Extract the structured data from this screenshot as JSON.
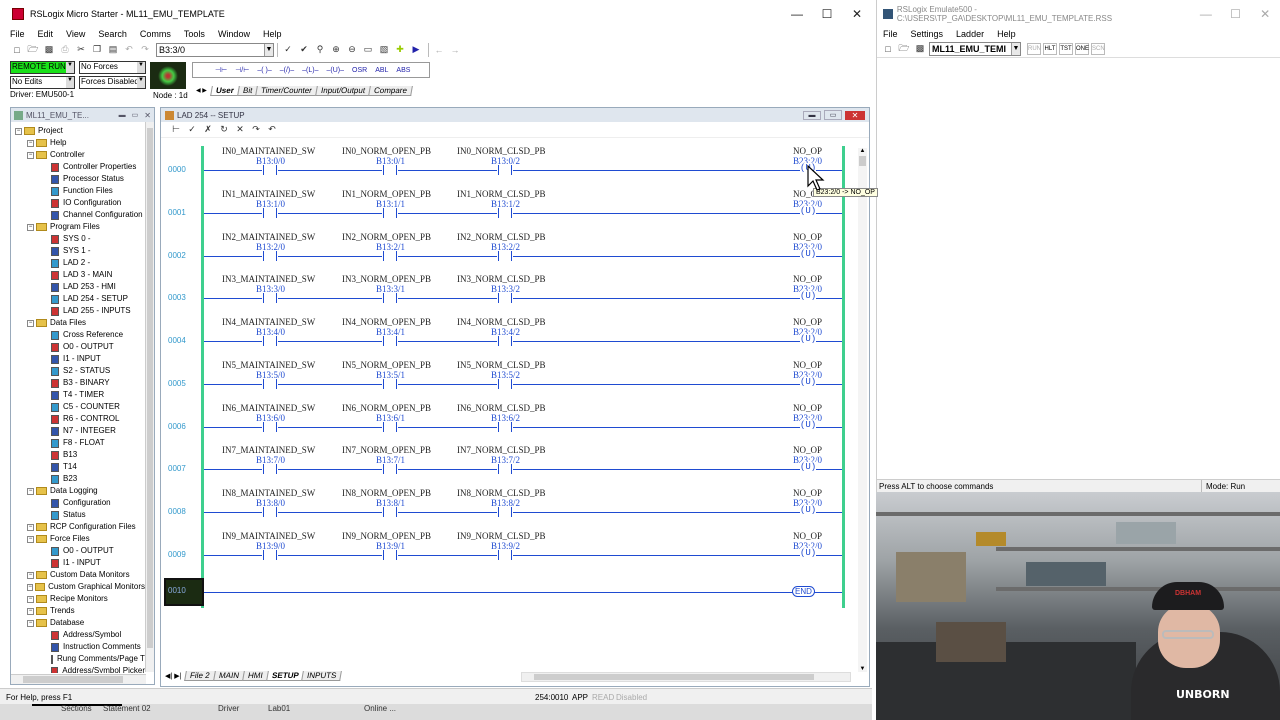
{
  "left_app": {
    "title": "RSLogix Micro Starter - ML11_EMU_TEMPLATE",
    "menu": [
      "File",
      "Edit",
      "View",
      "Search",
      "Comms",
      "Tools",
      "Window",
      "Help"
    ],
    "address_box": "B3:3/0",
    "status": {
      "mode": "REMOTE RUN",
      "edits": "No Edits",
      "forces": "No Forces",
      "forces_enabled": "Forces Disabled",
      "driver": "Driver: EMU500-1",
      "node": "Node : 1d"
    },
    "instr_tabs": [
      "User",
      "Bit",
      "Timer/Counter",
      "Input/Output",
      "Compare"
    ],
    "instr_symbols": [
      "⊣⊢",
      "⊣/⊢",
      "–( )–",
      "–(/)–",
      "–(L)–",
      "–(U)–",
      "OSR",
      "ABL",
      "ABS"
    ]
  },
  "project_tree": {
    "title": "ML11_EMU_TE...",
    "items": [
      {
        "label": "Project",
        "level": 0,
        "kind": "folder"
      },
      {
        "label": "Help",
        "level": 1,
        "kind": "folder"
      },
      {
        "label": "Controller",
        "level": 1,
        "kind": "folder"
      },
      {
        "label": "Controller Properties",
        "level": 2,
        "kind": "file"
      },
      {
        "label": "Processor Status",
        "level": 2,
        "kind": "file"
      },
      {
        "label": "Function Files",
        "level": 2,
        "kind": "file"
      },
      {
        "label": "IO Configuration",
        "level": 2,
        "kind": "file"
      },
      {
        "label": "Channel Configuration",
        "level": 2,
        "kind": "file"
      },
      {
        "label": "Program Files",
        "level": 1,
        "kind": "folder"
      },
      {
        "label": "SYS 0 -",
        "level": 2,
        "kind": "file"
      },
      {
        "label": "SYS 1 -",
        "level": 2,
        "kind": "file"
      },
      {
        "label": "LAD 2 -",
        "level": 2,
        "kind": "file"
      },
      {
        "label": "LAD 3 - MAIN",
        "level": 2,
        "kind": "file"
      },
      {
        "label": "LAD 253 - HMI",
        "level": 2,
        "kind": "file"
      },
      {
        "label": "LAD 254 - SETUP",
        "level": 2,
        "kind": "file"
      },
      {
        "label": "LAD 255 - INPUTS",
        "level": 2,
        "kind": "file"
      },
      {
        "label": "Data Files",
        "level": 1,
        "kind": "folder"
      },
      {
        "label": "Cross Reference",
        "level": 2,
        "kind": "file"
      },
      {
        "label": "O0 - OUTPUT",
        "level": 2,
        "kind": "file"
      },
      {
        "label": "I1 - INPUT",
        "level": 2,
        "kind": "file"
      },
      {
        "label": "S2 - STATUS",
        "level": 2,
        "kind": "file"
      },
      {
        "label": "B3 - BINARY",
        "level": 2,
        "kind": "file"
      },
      {
        "label": "T4 - TIMER",
        "level": 2,
        "kind": "file"
      },
      {
        "label": "C5 - COUNTER",
        "level": 2,
        "kind": "file"
      },
      {
        "label": "R6 - CONTROL",
        "level": 2,
        "kind": "file"
      },
      {
        "label": "N7 - INTEGER",
        "level": 2,
        "kind": "file"
      },
      {
        "label": "F8 - FLOAT",
        "level": 2,
        "kind": "file"
      },
      {
        "label": "B13",
        "level": 2,
        "kind": "file"
      },
      {
        "label": "T14",
        "level": 2,
        "kind": "file"
      },
      {
        "label": "B23",
        "level": 2,
        "kind": "file"
      },
      {
        "label": "Data Logging",
        "level": 1,
        "kind": "folder"
      },
      {
        "label": "Configuration",
        "level": 2,
        "kind": "file"
      },
      {
        "label": "Status",
        "level": 2,
        "kind": "file"
      },
      {
        "label": "RCP Configuration Files",
        "level": 1,
        "kind": "folder"
      },
      {
        "label": "Force Files",
        "level": 1,
        "kind": "folder"
      },
      {
        "label": "O0 - OUTPUT",
        "level": 2,
        "kind": "file"
      },
      {
        "label": "I1 - INPUT",
        "level": 2,
        "kind": "file"
      },
      {
        "label": "Custom Data Monitors",
        "level": 1,
        "kind": "folder"
      },
      {
        "label": "Custom Graphical Monitors",
        "level": 1,
        "kind": "folder"
      },
      {
        "label": "Recipe Monitors",
        "level": 1,
        "kind": "folder"
      },
      {
        "label": "Trends",
        "level": 1,
        "kind": "folder"
      },
      {
        "label": "Database",
        "level": 1,
        "kind": "folder"
      },
      {
        "label": "Address/Symbol",
        "level": 2,
        "kind": "file"
      },
      {
        "label": "Instruction Comments",
        "level": 2,
        "kind": "file"
      },
      {
        "label": "Rung Comments/Page Ti",
        "level": 2,
        "kind": "file"
      },
      {
        "label": "Address/Symbol Picker",
        "level": 2,
        "kind": "file"
      }
    ]
  },
  "ladder": {
    "title": "LAD 254 -- SETUP",
    "rungs": [
      {
        "num": "0000",
        "c1": "IN0_MAINTAINED_SW",
        "a1": "B13:0/0",
        "c2": "IN0_NORM_OPEN_PB",
        "a2": "B13:0/1",
        "c3": "IN0_NORM_CLSD_PB",
        "a3": "B13:0/2",
        "out": "NO_OP",
        "oa": "B23:2/0"
      },
      {
        "num": "0001",
        "c1": "IN1_MAINTAINED_SW",
        "a1": "B13:1/0",
        "c2": "IN1_NORM_OPEN_PB",
        "a2": "B13:1/1",
        "c3": "IN1_NORM_CLSD_PB",
        "a3": "B13:1/2",
        "out": "NO_O",
        "oa": "B23:2/0"
      },
      {
        "num": "0002",
        "c1": "IN2_MAINTAINED_SW",
        "a1": "B13:2/0",
        "c2": "IN2_NORM_OPEN_PB",
        "a2": "B13:2/1",
        "c3": "IN2_NORM_CLSD_PB",
        "a3": "B13:2/2",
        "out": "NO_OP",
        "oa": "B23:2/0"
      },
      {
        "num": "0003",
        "c1": "IN3_MAINTAINED_SW",
        "a1": "B13:3/0",
        "c2": "IN3_NORM_OPEN_PB",
        "a2": "B13:3/1",
        "c3": "IN3_NORM_CLSD_PB",
        "a3": "B13:3/2",
        "out": "NO_OP",
        "oa": "B23:2/0"
      },
      {
        "num": "0004",
        "c1": "IN4_MAINTAINED_SW",
        "a1": "B13:4/0",
        "c2": "IN4_NORM_OPEN_PB",
        "a2": "B13:4/1",
        "c3": "IN4_NORM_CLSD_PB",
        "a3": "B13:4/2",
        "out": "NO_OP",
        "oa": "B23:2/0"
      },
      {
        "num": "0005",
        "c1": "IN5_MAINTAINED_SW",
        "a1": "B13:5/0",
        "c2": "IN5_NORM_OPEN_PB",
        "a2": "B13:5/1",
        "c3": "IN5_NORM_CLSD_PB",
        "a3": "B13:5/2",
        "out": "NO_OP",
        "oa": "B23:2/0"
      },
      {
        "num": "0006",
        "c1": "IN6_MAINTAINED_SW",
        "a1": "B13:6/0",
        "c2": "IN6_NORM_OPEN_PB",
        "a2": "B13:6/1",
        "c3": "IN6_NORM_CLSD_PB",
        "a3": "B13:6/2",
        "out": "NO_OP",
        "oa": "B23:2/0"
      },
      {
        "num": "0007",
        "c1": "IN7_MAINTAINED_SW",
        "a1": "B13:7/0",
        "c2": "IN7_NORM_OPEN_PB",
        "a2": "B13:7/1",
        "c3": "IN7_NORM_CLSD_PB",
        "a3": "B13:7/2",
        "out": "NO_OP",
        "oa": "B23:2/0"
      },
      {
        "num": "0008",
        "c1": "IN8_MAINTAINED_SW",
        "a1": "B13:8/0",
        "c2": "IN8_NORM_OPEN_PB",
        "a2": "B13:8/1",
        "c3": "IN8_NORM_CLSD_PB",
        "a3": "B13:8/2",
        "out": "NO_OP",
        "oa": "B23:2/0"
      },
      {
        "num": "0009",
        "c1": "IN9_MAINTAINED_SW",
        "a1": "B13:9/0",
        "c2": "IN9_NORM_OPEN_PB",
        "a2": "B13:9/1",
        "c3": "IN9_NORM_CLSD_PB",
        "a3": "B13:9/2",
        "out": "NO_OP",
        "oa": "B23:2/0"
      }
    ],
    "end_rung": "0010",
    "end_label": "END",
    "tooltip": "B23:2/0 -> NO_OP",
    "file_tabs": [
      "File 2",
      "MAIN",
      "HMI",
      "SETUP",
      "INPUTS"
    ],
    "active_tab": "SETUP",
    "status_addr": "254:0010",
    "status_flags": [
      "APP",
      "READ",
      "Disabled"
    ]
  },
  "status_bar": {
    "help": "For Help, press F1",
    "taskbar": [
      "Sections",
      "Statement 02",
      "Driver",
      "Lab01",
      "Online ..."
    ]
  },
  "right_app": {
    "title": "RSLogix Emulate500 - C:\\USERS\\TP_GA\\DESKTOP\\ML11_EMU_TEMPLATE.RSS",
    "menu": [
      "File",
      "Settings",
      "Ladder",
      "Help"
    ],
    "processor": "ML11_EMU_TEMI",
    "toolbar_btns": [
      "RUN",
      "HLT",
      "TST",
      "ONE",
      "SCN"
    ],
    "status_left": "Press ALT to choose commands",
    "status_mode": "Mode: Run"
  },
  "webcam": {
    "shirt_text": "UNBORN",
    "hat_text": "DBHAM"
  },
  "colors": {
    "green_rail": "#3ecf8e",
    "blue_text": "#1f4bd1",
    "run_green": "#19e119"
  }
}
